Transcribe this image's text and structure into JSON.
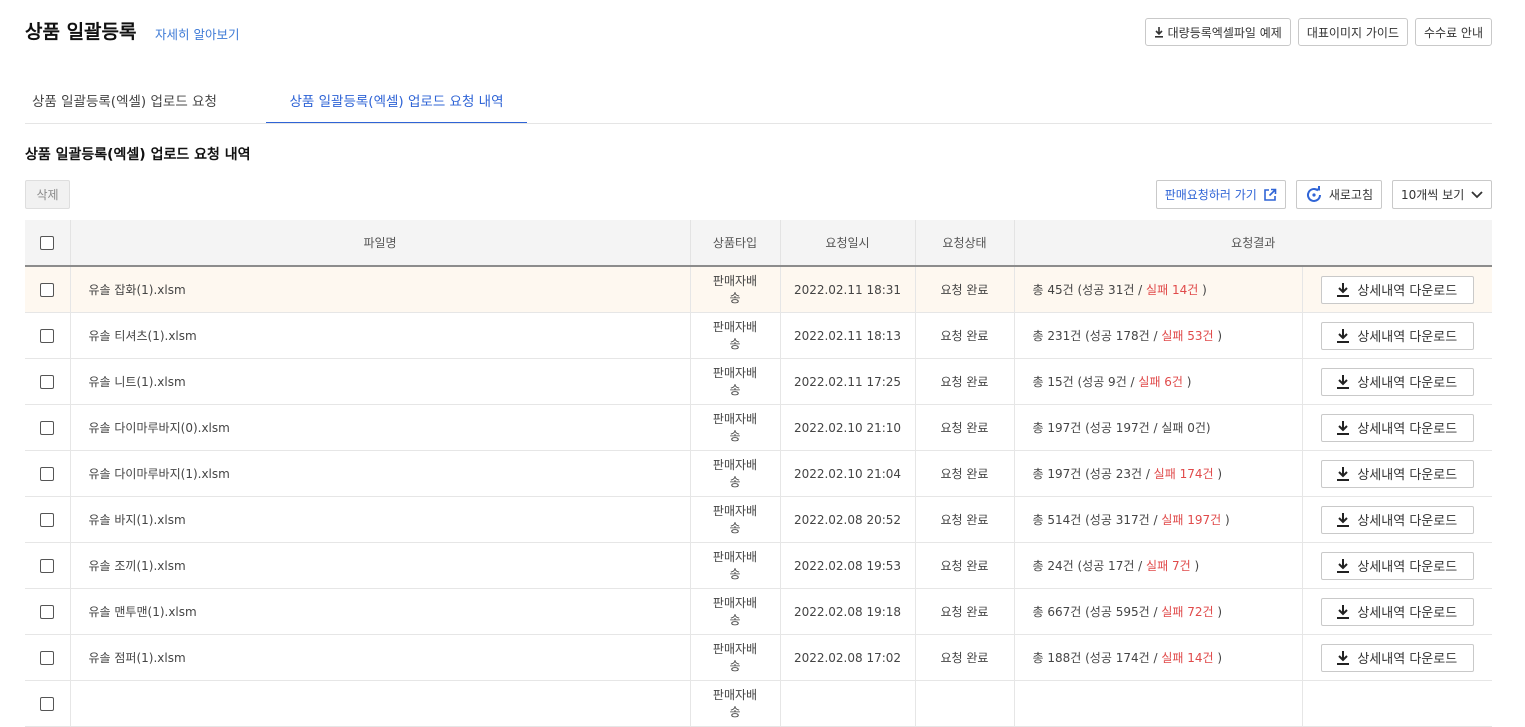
{
  "header": {
    "title": "상품 일괄등록",
    "learn_more": "자세히 알아보기",
    "buttons": {
      "sample_file": "대량등록엑셀파일 예제",
      "image_guide": "대표이미지 가이드",
      "fee_info": "수수료 안내"
    }
  },
  "tabs": [
    {
      "label": "상품 일괄등록(엑셀) 업로드 요청",
      "active": false
    },
    {
      "label": "상품 일괄등록(엑셀) 업로드 요청 내역",
      "active": true
    }
  ],
  "section": {
    "title": "상품 일괄등록(엑셀) 업로드 요청 내역",
    "delete_label": "삭제",
    "go_sales_label": "판매요청하러 가기",
    "refresh_label": "새로고침",
    "page_size_label": "10개씩 보기"
  },
  "table": {
    "columns": [
      "파일명",
      "상품타입",
      "요청일시",
      "요청상태",
      "요청결과"
    ],
    "download_label": "상세내역 다운로드",
    "rows": [
      {
        "file": "유솔 잡화(1).xlsm",
        "type_line1": "판매자배",
        "type_line2": "송",
        "date": "2022.02.11 18:31",
        "status": "요청 완료",
        "result_prefix": "총 45건 (성공 31건 / ",
        "result_fail": "실패 14건",
        "result_suffix": " )",
        "fail_red": true
      },
      {
        "file": "유솔 티셔츠(1).xlsm",
        "type_line1": "판매자배",
        "type_line2": "송",
        "date": "2022.02.11 18:13",
        "status": "요청 완료",
        "result_prefix": "총 231건 (성공 178건 / ",
        "result_fail": "실패 53건",
        "result_suffix": " )",
        "fail_red": true
      },
      {
        "file": "유솔 니트(1).xlsm",
        "type_line1": "판매자배",
        "type_line2": "송",
        "date": "2022.02.11 17:25",
        "status": "요청 완료",
        "result_prefix": "총 15건 (성공 9건 / ",
        "result_fail": "실패 6건",
        "result_suffix": " )",
        "fail_red": true
      },
      {
        "file": "유솔 다이마루바지(0).xlsm",
        "type_line1": "판매자배",
        "type_line2": "송",
        "date": "2022.02.10 21:10",
        "status": "요청 완료",
        "result_prefix": "총 197건 (성공 197건 / ",
        "result_fail": "실패 0건",
        "result_suffix": ")",
        "fail_red": false
      },
      {
        "file": "유솔 다이마루바지(1).xlsm",
        "type_line1": "판매자배",
        "type_line2": "송",
        "date": "2022.02.10 21:04",
        "status": "요청 완료",
        "result_prefix": "총 197건 (성공 23건 / ",
        "result_fail": "실패 174건",
        "result_suffix": " )",
        "fail_red": true
      },
      {
        "file": "유솔 바지(1).xlsm",
        "type_line1": "판매자배",
        "type_line2": "송",
        "date": "2022.02.08 20:52",
        "status": "요청 완료",
        "result_prefix": "총 514건 (성공 317건 / ",
        "result_fail": "실패 197건",
        "result_suffix": " )",
        "fail_red": true
      },
      {
        "file": "유솔 조끼(1).xlsm",
        "type_line1": "판매자배",
        "type_line2": "송",
        "date": "2022.02.08 19:53",
        "status": "요청 완료",
        "result_prefix": "총 24건 (성공 17건 / ",
        "result_fail": "실패 7건",
        "result_suffix": " )",
        "fail_red": true
      },
      {
        "file": "유솔 맨투맨(1).xlsm",
        "type_line1": "판매자배",
        "type_line2": "송",
        "date": "2022.02.08 19:18",
        "status": "요청 완료",
        "result_prefix": "총 667건 (성공 595건 / ",
        "result_fail": "실패 72건",
        "result_suffix": " )",
        "fail_red": true
      },
      {
        "file": "유솔 점퍼(1).xlsm",
        "type_line1": "판매자배",
        "type_line2": "송",
        "date": "2022.02.08 17:02",
        "status": "요청 완료",
        "result_prefix": "총 188건 (성공 174건 / ",
        "result_fail": "실패 14건",
        "result_suffix": " )",
        "fail_red": true
      },
      {
        "file": "",
        "type_line1": "판매자배",
        "type_line2": "송",
        "date": "",
        "status": "",
        "result_prefix": "",
        "result_fail": "",
        "result_suffix": "",
        "fail_red": false
      }
    ]
  },
  "colors": {
    "accent": "#2f64d6",
    "fail": "#e04a4a",
    "highlight_row": "#fef8f0"
  },
  "icons": [
    "download-icon",
    "external-link-icon",
    "refresh-icon",
    "chevron-down-icon"
  ]
}
